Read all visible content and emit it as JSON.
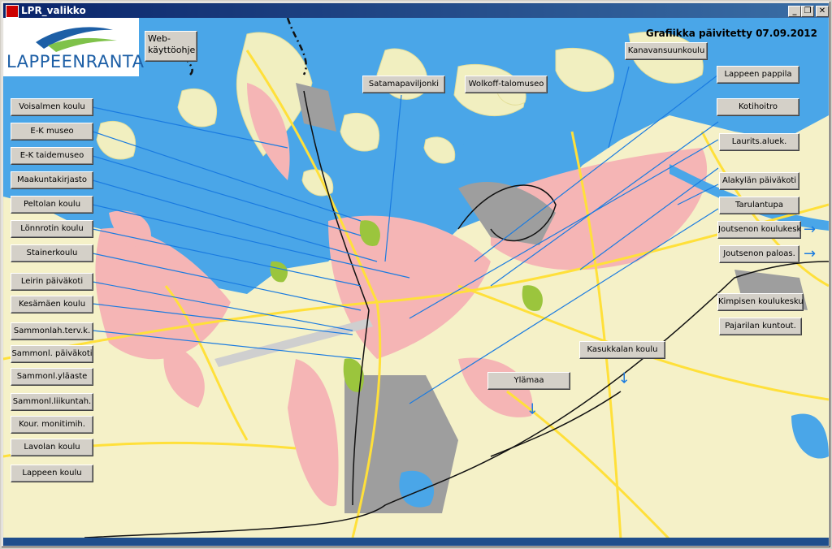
{
  "window": {
    "title": "LPR_valikko",
    "minimize": "_",
    "restore": "❐",
    "close": "✕"
  },
  "logo": {
    "wordmark": "LAPPEENRANTA"
  },
  "graphics_date": "Grafiikka päivitetty 07.09.2012",
  "web_help": {
    "line1": "Web-",
    "line2": "käyttöohje"
  },
  "left_buttons": [
    "Voisalmen koulu",
    "E-K museo",
    "E-K taidemuseo",
    "Maakuntakirjasto",
    "Peltolan koulu",
    "Lönnrotin koulu",
    "Stainerkoulu",
    "Leirin päiväkoti",
    "Kesämäen koulu",
    "Sammonlah.terv.k.",
    "Sammonl. päiväkoti",
    "Sammonl.yläaste",
    "Sammonl.liikuntah.",
    "Kour. monitimih.",
    "Lavolan koulu",
    "Lappeen koulu"
  ],
  "top_buttons": {
    "satamapaviljonki": "Satamapaviljonki",
    "wolkoff": "Wolkoff-talomuseo",
    "kanavansuu": "Kanavansuunkoulu"
  },
  "right_buttons": [
    "Lappeen pappila",
    "Kotihoitro",
    "Laurits.aluek.",
    "Alakylän päiväkoti",
    "Tarulantupa",
    "Joutsenon koulukesk.",
    "Joutsenon paloas.",
    "Kimpisen koulukeskus",
    "Pajarilan kuntout."
  ],
  "center_buttons": {
    "kasukkala": "Kasukkalan koulu",
    "ylamaa": "Ylämaa"
  },
  "colors": {
    "water": "#4aa6e8",
    "land": "#f5f1c8",
    "urban": "#f5b5b5",
    "industrial": "#9e9e9e",
    "road": "#ffe03a",
    "leader_line": "#1a7be0",
    "title_bar": "#0a246a"
  }
}
